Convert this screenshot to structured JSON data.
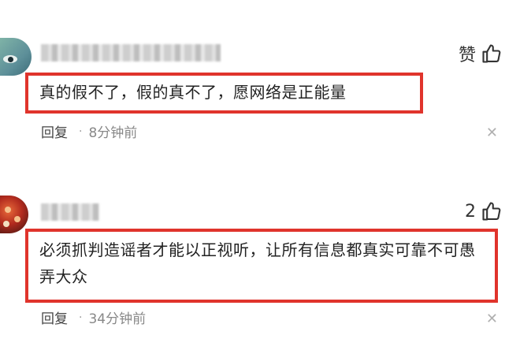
{
  "comments": [
    {
      "like_label": "赞",
      "text": "真的假不了，假的真不了，愿网络是正能量",
      "reply_label": "回复",
      "separator": "·",
      "time": "8分钟前",
      "close_glyph": "✕"
    },
    {
      "like_label": "2",
      "text": "必须抓判造谣者才能以正视听，让所有信息都真实可靠不可愚弄大众",
      "reply_label": "回复",
      "separator": "·",
      "time": "34分钟前",
      "close_glyph": "✕"
    }
  ],
  "colors": {
    "highlight_box": "#e0342c",
    "meta_text": "#888888"
  },
  "icons": {
    "like": "thumbs-up-icon",
    "close": "close-icon"
  }
}
